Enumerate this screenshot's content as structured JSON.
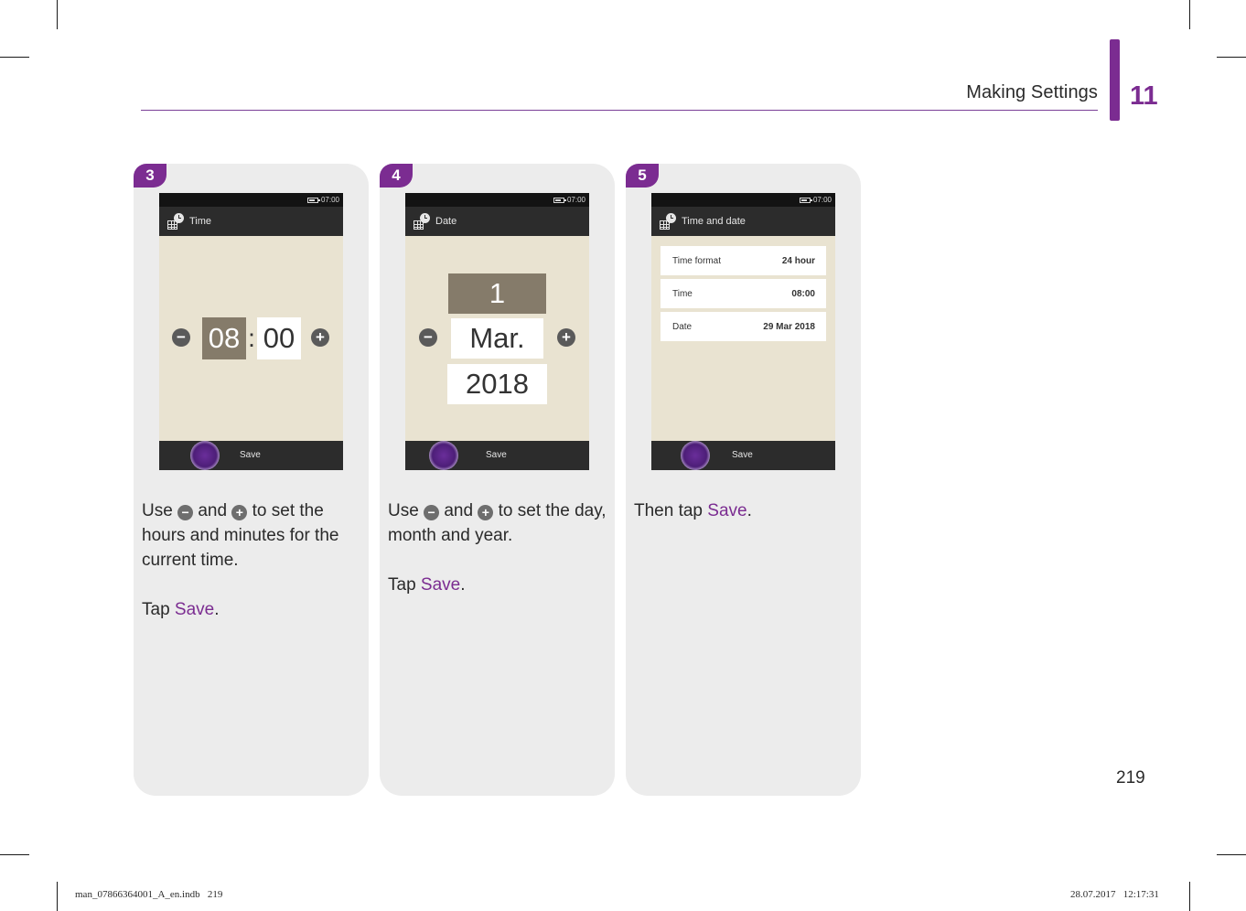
{
  "header": {
    "section_title": "Making Settings",
    "chapter_number": "11"
  },
  "steps": [
    {
      "number": "3",
      "screen": {
        "status_time": "07:00",
        "title": "Time",
        "hours": "08",
        "separator": ":",
        "minutes": "00",
        "minus_glyph": "−",
        "plus_glyph": "+",
        "save_label": "Save"
      },
      "caption": {
        "use": "Use",
        "and": "and",
        "rest": "to set the hours and minutes for the current time.",
        "tap": "Tap",
        "save": "Save",
        "period": "."
      }
    },
    {
      "number": "4",
      "screen": {
        "status_time": "07:00",
        "title": "Date",
        "day": "1",
        "month": "Mar.",
        "year": "2018",
        "minus_glyph": "−",
        "plus_glyph": "+",
        "save_label": "Save"
      },
      "caption": {
        "use": "Use",
        "and": "and",
        "rest": "to set the day, month and year.",
        "tap": "Tap",
        "save": "Save",
        "period": "."
      }
    },
    {
      "number": "5",
      "screen": {
        "status_time": "07:00",
        "title": "Time and date",
        "rows": [
          {
            "label": "Time format",
            "value": "24 hour"
          },
          {
            "label": "Time",
            "value": "08:00"
          },
          {
            "label": "Date",
            "value": "29 Mar 2018"
          }
        ],
        "save_label": "Save"
      },
      "caption": {
        "then_tap": "Then tap",
        "save": "Save",
        "period": "."
      }
    }
  ],
  "page_number": "219",
  "footer": {
    "file": "man_07866364001_A_en.indb   219",
    "timestamp": "28.07.2017   12:17:31"
  },
  "colors": {
    "accent": "#7b2c91",
    "card_bg": "#ececec",
    "screen_bg": "#e9e3d1",
    "bar_bg": "#2c2c2c"
  },
  "icons": {
    "minus": "minus-circle-icon",
    "plus": "plus-circle-icon",
    "settings": "time-date-settings-icon",
    "battery": "battery-icon"
  }
}
